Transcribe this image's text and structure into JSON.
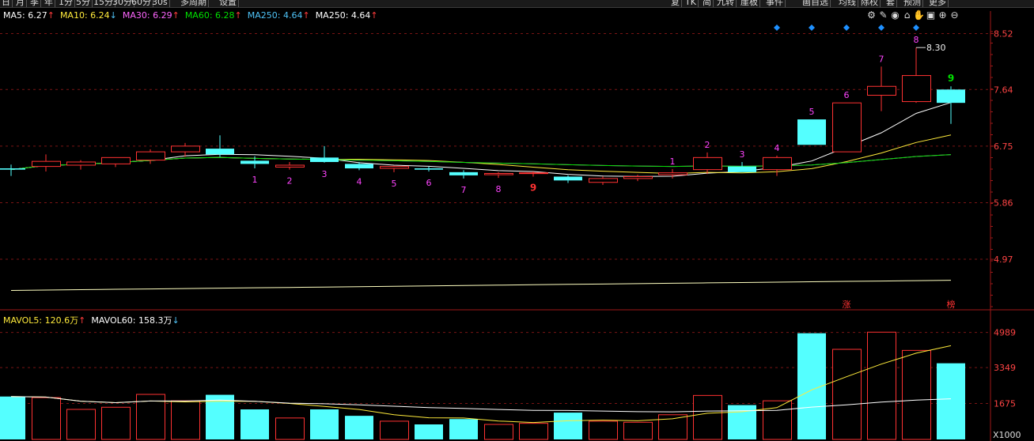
{
  "toolbar": {
    "left_items": [
      "日",
      "月",
      "季",
      "年",
      "1分",
      "5分",
      "15分",
      "30分",
      "60分",
      "30s",
      "多周期",
      "设置"
    ],
    "right_items": [
      "复",
      "TK",
      "简",
      "九转",
      "崖板",
      "事件",
      "画自选",
      "均线",
      "除权",
      "套",
      "预测",
      "更多"
    ]
  },
  "tool_icons": [
    "settings-icon",
    "edit-icon",
    "eye-icon",
    "store-icon",
    "hand-icon",
    "lock-icon",
    "plus-icon",
    "minus-icon"
  ],
  "ma_legend": [
    {
      "label": "MA5:",
      "value": "6.27",
      "trend": "up",
      "color": "#ffffff"
    },
    {
      "label": "MA10:",
      "value": "6.24",
      "trend": "down",
      "color": "#ffeb3b"
    },
    {
      "label": "MA30:",
      "value": "6.29",
      "trend": "up",
      "color": "#ff66ff"
    },
    {
      "label": "MA60:",
      "value": "6.28",
      "trend": "up",
      "color": "#00e000"
    },
    {
      "label": "MA250:",
      "value": "4.64",
      "trend": "up",
      "color": "#4fc3f7"
    },
    {
      "label": "MA250:",
      "value": "4.64",
      "trend": "up",
      "color": "#ffffff"
    }
  ],
  "vol_legend": [
    {
      "label": "MAVOL5:",
      "value": "120.6万",
      "trend": "up",
      "color": "#ffeb3b"
    },
    {
      "label": "MAVOL60:",
      "value": "158.3万",
      "trend": "down",
      "color": "#ffffff"
    }
  ],
  "chart_data": {
    "type": "candlestick",
    "price_axis": {
      "ticks": [
        8.52,
        7.64,
        6.75,
        5.86,
        4.97
      ],
      "range": [
        4.2,
        8.7
      ]
    },
    "volume_axis": {
      "ticks": [
        "4989",
        "3349",
        "1675"
      ],
      "unit": "X1000",
      "range": [
        0,
        5600
      ]
    },
    "price_label": "8.30",
    "markers": [
      "涨",
      "榜"
    ],
    "candles": [
      {
        "o": 6.4,
        "h": 6.46,
        "l": 6.28,
        "c": 6.38,
        "v": 2000,
        "cnt": ""
      },
      {
        "o": 6.43,
        "h": 6.62,
        "l": 6.35,
        "c": 6.51,
        "v": 1950,
        "cnt": ""
      },
      {
        "o": 6.45,
        "h": 6.53,
        "l": 6.38,
        "c": 6.5,
        "v": 1400,
        "cnt": ""
      },
      {
        "o": 6.47,
        "h": 6.57,
        "l": 6.42,
        "c": 6.57,
        "v": 1500,
        "cnt": ""
      },
      {
        "o": 6.53,
        "h": 6.7,
        "l": 6.47,
        "c": 6.66,
        "v": 2100,
        "cnt": ""
      },
      {
        "o": 6.66,
        "h": 6.8,
        "l": 6.58,
        "c": 6.75,
        "v": 1800,
        "cnt": ""
      },
      {
        "o": 6.71,
        "h": 6.92,
        "l": 6.58,
        "c": 6.62,
        "v": 2080,
        "cnt": ""
      },
      {
        "o": 6.52,
        "h": 6.59,
        "l": 6.4,
        "c": 6.47,
        "v": 1400,
        "cnt": "1"
      },
      {
        "o": 6.42,
        "h": 6.5,
        "l": 6.38,
        "c": 6.45,
        "v": 1000,
        "cnt": "2"
      },
      {
        "o": 6.57,
        "h": 6.75,
        "l": 6.49,
        "c": 6.5,
        "v": 1400,
        "cnt": "3"
      },
      {
        "o": 6.47,
        "h": 6.5,
        "l": 6.37,
        "c": 6.4,
        "v": 1100,
        "cnt": "4"
      },
      {
        "o": 6.4,
        "h": 6.44,
        "l": 6.34,
        "c": 6.43,
        "v": 850,
        "cnt": "5"
      },
      {
        "o": 6.4,
        "h": 6.43,
        "l": 6.35,
        "c": 6.38,
        "v": 700,
        "cnt": "6"
      },
      {
        "o": 6.34,
        "h": 6.37,
        "l": 6.24,
        "c": 6.29,
        "v": 950,
        "cnt": "7"
      },
      {
        "o": 6.3,
        "h": 6.34,
        "l": 6.25,
        "c": 6.32,
        "v": 700,
        "cnt": "8"
      },
      {
        "o": 6.32,
        "h": 6.35,
        "l": 6.27,
        "c": 6.33,
        "v": 750,
        "cnt": "9"
      },
      {
        "o": 6.27,
        "h": 6.29,
        "l": 6.17,
        "c": 6.21,
        "v": 1250,
        "cnt": ""
      },
      {
        "o": 6.18,
        "h": 6.27,
        "l": 6.14,
        "c": 6.24,
        "v": 850,
        "cnt": ""
      },
      {
        "o": 6.24,
        "h": 6.3,
        "l": 6.2,
        "c": 6.27,
        "v": 800,
        "cnt": ""
      },
      {
        "o": 6.3,
        "h": 6.39,
        "l": 6.24,
        "c": 6.33,
        "v": 1150,
        "cnt": "1"
      },
      {
        "o": 6.38,
        "h": 6.65,
        "l": 6.31,
        "c": 6.57,
        "v": 2050,
        "cnt": "2"
      },
      {
        "o": 6.43,
        "h": 6.5,
        "l": 6.34,
        "c": 6.34,
        "v": 1600,
        "cnt": "3"
      },
      {
        "o": 6.38,
        "h": 6.6,
        "l": 6.28,
        "c": 6.57,
        "v": 1800,
        "cnt": "4"
      },
      {
        "o": 7.17,
        "h": 7.17,
        "l": 6.77,
        "c": 6.77,
        "v": 4950,
        "cnt": "5"
      },
      {
        "o": 6.66,
        "h": 7.43,
        "l": 6.66,
        "c": 7.43,
        "v": 4200,
        "cnt": "6"
      },
      {
        "o": 7.55,
        "h": 8.0,
        "l": 7.3,
        "c": 7.69,
        "v": 5000,
        "cnt": "7"
      },
      {
        "o": 7.45,
        "h": 8.3,
        "l": 7.43,
        "c": 7.86,
        "v": 4150,
        "cnt": "8"
      },
      {
        "o": 7.64,
        "h": 7.69,
        "l": 7.1,
        "c": 7.43,
        "v": 3550,
        "cnt": "9"
      }
    ]
  }
}
